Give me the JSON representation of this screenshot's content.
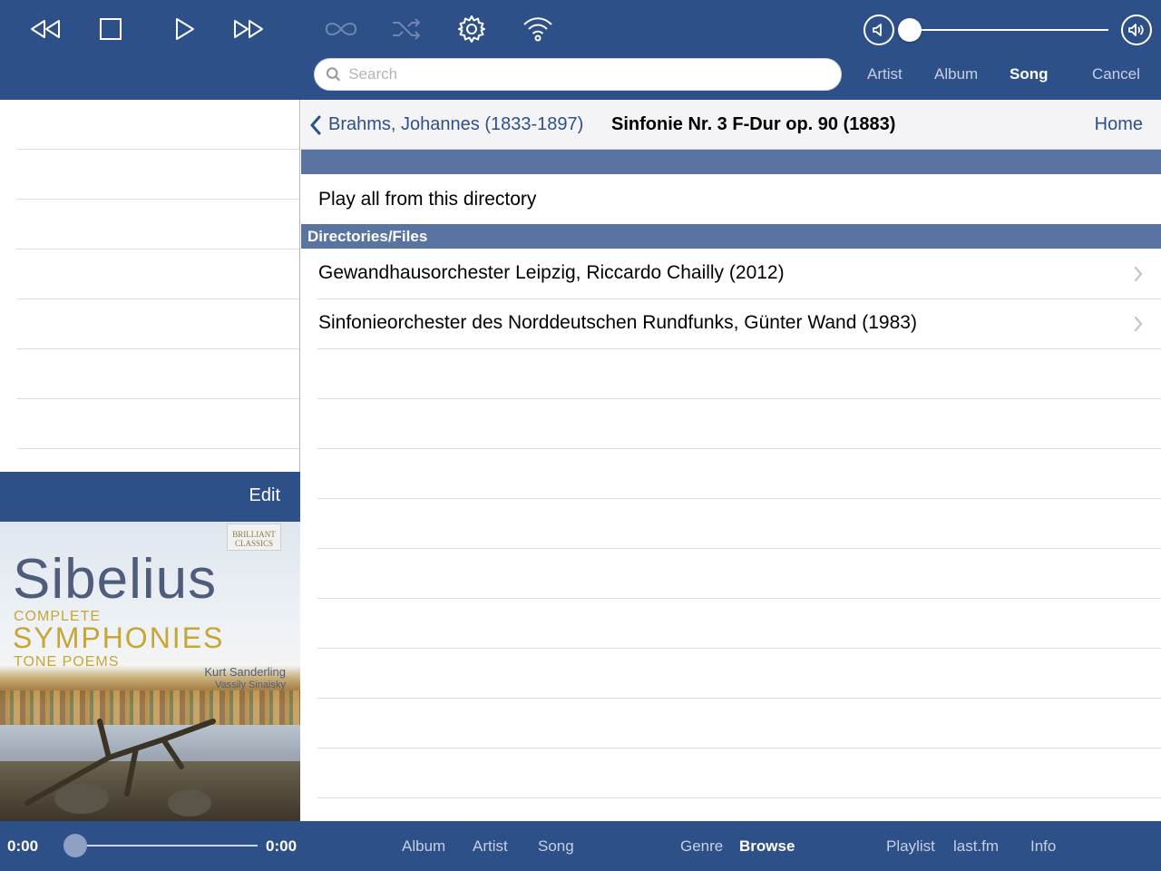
{
  "toolbar": {
    "icons": [
      "rewind-icon",
      "stop-icon",
      "play-icon",
      "fast-forward-icon",
      "repeat-icon",
      "shuffle-icon",
      "settings-gear-icon",
      "wifi-icon"
    ],
    "dimmed_icons": [
      "repeat-icon",
      "shuffle-icon"
    ]
  },
  "volume": {
    "level": 0.0,
    "down_icon": "volume-down-icon",
    "up_icon": "volume-up-icon"
  },
  "search": {
    "placeholder": "Search",
    "value": "",
    "scopes": [
      "Artist",
      "Album",
      "Song"
    ],
    "active_scope": "Song",
    "cancel_label": "Cancel"
  },
  "left": {
    "edit_label": "Edit",
    "cover": {
      "brand": "BRILLIANT CLASSICS",
      "title": "Sibelius",
      "line1": "COMPLETE",
      "line2": "SYMPHONIES",
      "line3": "TONE POEMS",
      "performer1": "Kurt Sanderling",
      "performer2": "Vassily Sinaisky"
    }
  },
  "navbar": {
    "back_label": "Brahms, Johannes (1833-1897)",
    "title": "Sinfonie Nr. 3 F-Dur op. 90 (1883)",
    "home_label": "Home"
  },
  "content": {
    "play_all": "Play all from this directory",
    "section_header": "Directories/Files",
    "rows": [
      {
        "label": "Gewandhausorchester Leipzig, Riccardo Chailly (2012)"
      },
      {
        "label": "Sinfonieorchester des Norddeutschen Rundfunks, Günter Wand (1983)"
      }
    ]
  },
  "bottombar": {
    "elapsed": "0:00",
    "remaining": "0:00",
    "progress": 0.0,
    "tabs": [
      "Album",
      "Artist",
      "Song",
      "Genre",
      "Browse",
      "Playlist",
      "last.fm",
      "Info"
    ],
    "active_tab": "Browse"
  },
  "colors": {
    "bar": "#2e5088",
    "section": "#5a74a2",
    "accent": "#2e5088"
  }
}
